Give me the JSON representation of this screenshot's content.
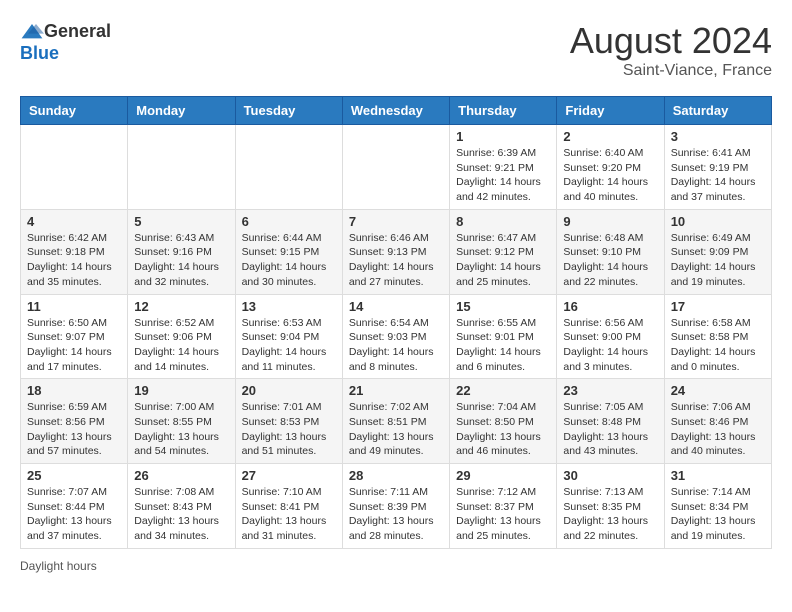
{
  "header": {
    "logo_general": "General",
    "logo_blue": "Blue",
    "month_title": "August 2024",
    "location": "Saint-Viance, France"
  },
  "days_of_week": [
    "Sunday",
    "Monday",
    "Tuesday",
    "Wednesday",
    "Thursday",
    "Friday",
    "Saturday"
  ],
  "footer": {
    "daylight_label": "Daylight hours"
  },
  "weeks": [
    [
      {
        "day": "",
        "info": ""
      },
      {
        "day": "",
        "info": ""
      },
      {
        "day": "",
        "info": ""
      },
      {
        "day": "",
        "info": ""
      },
      {
        "day": "1",
        "info": "Sunrise: 6:39 AM\nSunset: 9:21 PM\nDaylight: 14 hours\nand 42 minutes."
      },
      {
        "day": "2",
        "info": "Sunrise: 6:40 AM\nSunset: 9:20 PM\nDaylight: 14 hours\nand 40 minutes."
      },
      {
        "day": "3",
        "info": "Sunrise: 6:41 AM\nSunset: 9:19 PM\nDaylight: 14 hours\nand 37 minutes."
      }
    ],
    [
      {
        "day": "4",
        "info": "Sunrise: 6:42 AM\nSunset: 9:18 PM\nDaylight: 14 hours\nand 35 minutes."
      },
      {
        "day": "5",
        "info": "Sunrise: 6:43 AM\nSunset: 9:16 PM\nDaylight: 14 hours\nand 32 minutes."
      },
      {
        "day": "6",
        "info": "Sunrise: 6:44 AM\nSunset: 9:15 PM\nDaylight: 14 hours\nand 30 minutes."
      },
      {
        "day": "7",
        "info": "Sunrise: 6:46 AM\nSunset: 9:13 PM\nDaylight: 14 hours\nand 27 minutes."
      },
      {
        "day": "8",
        "info": "Sunrise: 6:47 AM\nSunset: 9:12 PM\nDaylight: 14 hours\nand 25 minutes."
      },
      {
        "day": "9",
        "info": "Sunrise: 6:48 AM\nSunset: 9:10 PM\nDaylight: 14 hours\nand 22 minutes."
      },
      {
        "day": "10",
        "info": "Sunrise: 6:49 AM\nSunset: 9:09 PM\nDaylight: 14 hours\nand 19 minutes."
      }
    ],
    [
      {
        "day": "11",
        "info": "Sunrise: 6:50 AM\nSunset: 9:07 PM\nDaylight: 14 hours\nand 17 minutes."
      },
      {
        "day": "12",
        "info": "Sunrise: 6:52 AM\nSunset: 9:06 PM\nDaylight: 14 hours\nand 14 minutes."
      },
      {
        "day": "13",
        "info": "Sunrise: 6:53 AM\nSunset: 9:04 PM\nDaylight: 14 hours\nand 11 minutes."
      },
      {
        "day": "14",
        "info": "Sunrise: 6:54 AM\nSunset: 9:03 PM\nDaylight: 14 hours\nand 8 minutes."
      },
      {
        "day": "15",
        "info": "Sunrise: 6:55 AM\nSunset: 9:01 PM\nDaylight: 14 hours\nand 6 minutes."
      },
      {
        "day": "16",
        "info": "Sunrise: 6:56 AM\nSunset: 9:00 PM\nDaylight: 14 hours\nand 3 minutes."
      },
      {
        "day": "17",
        "info": "Sunrise: 6:58 AM\nSunset: 8:58 PM\nDaylight: 14 hours\nand 0 minutes."
      }
    ],
    [
      {
        "day": "18",
        "info": "Sunrise: 6:59 AM\nSunset: 8:56 PM\nDaylight: 13 hours\nand 57 minutes."
      },
      {
        "day": "19",
        "info": "Sunrise: 7:00 AM\nSunset: 8:55 PM\nDaylight: 13 hours\nand 54 minutes."
      },
      {
        "day": "20",
        "info": "Sunrise: 7:01 AM\nSunset: 8:53 PM\nDaylight: 13 hours\nand 51 minutes."
      },
      {
        "day": "21",
        "info": "Sunrise: 7:02 AM\nSunset: 8:51 PM\nDaylight: 13 hours\nand 49 minutes."
      },
      {
        "day": "22",
        "info": "Sunrise: 7:04 AM\nSunset: 8:50 PM\nDaylight: 13 hours\nand 46 minutes."
      },
      {
        "day": "23",
        "info": "Sunrise: 7:05 AM\nSunset: 8:48 PM\nDaylight: 13 hours\nand 43 minutes."
      },
      {
        "day": "24",
        "info": "Sunrise: 7:06 AM\nSunset: 8:46 PM\nDaylight: 13 hours\nand 40 minutes."
      }
    ],
    [
      {
        "day": "25",
        "info": "Sunrise: 7:07 AM\nSunset: 8:44 PM\nDaylight: 13 hours\nand 37 minutes."
      },
      {
        "day": "26",
        "info": "Sunrise: 7:08 AM\nSunset: 8:43 PM\nDaylight: 13 hours\nand 34 minutes."
      },
      {
        "day": "27",
        "info": "Sunrise: 7:10 AM\nSunset: 8:41 PM\nDaylight: 13 hours\nand 31 minutes."
      },
      {
        "day": "28",
        "info": "Sunrise: 7:11 AM\nSunset: 8:39 PM\nDaylight: 13 hours\nand 28 minutes."
      },
      {
        "day": "29",
        "info": "Sunrise: 7:12 AM\nSunset: 8:37 PM\nDaylight: 13 hours\nand 25 minutes."
      },
      {
        "day": "30",
        "info": "Sunrise: 7:13 AM\nSunset: 8:35 PM\nDaylight: 13 hours\nand 22 minutes."
      },
      {
        "day": "31",
        "info": "Sunrise: 7:14 AM\nSunset: 8:34 PM\nDaylight: 13 hours\nand 19 minutes."
      }
    ]
  ]
}
